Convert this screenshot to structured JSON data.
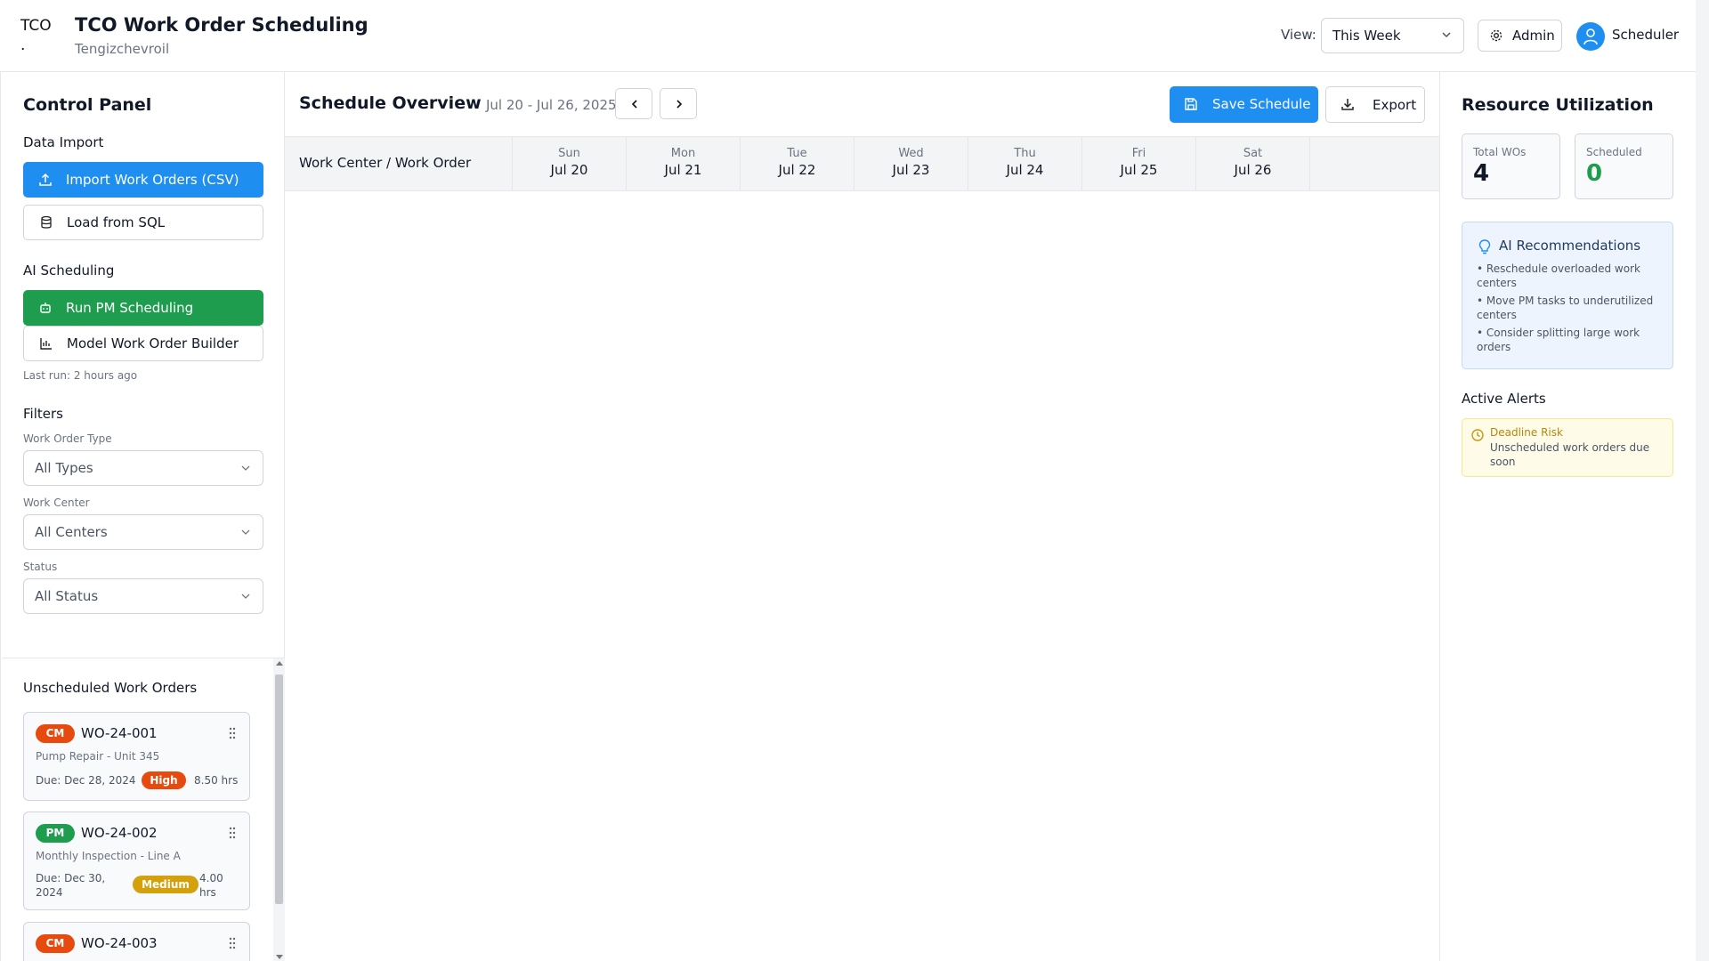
{
  "header": {
    "logo_alt": "TCO .",
    "title": "TCO Work Order Scheduling",
    "subtitle": "Tengizchevroil",
    "view_label": "View:",
    "view_value": "This Week",
    "admin_label": "Admin",
    "user_label": "Scheduler"
  },
  "left": {
    "title": "Control Panel",
    "data_import_label": "Data Import",
    "import_csv": "Import Work Orders (CSV)",
    "load_sql": "Load from SQL",
    "ai_label": "AI Scheduling",
    "run_pm": "Run PM Scheduling",
    "model_builder": "Model Work Order Builder",
    "last_run": "Last run: 2 hours ago",
    "filters_label": "Filters",
    "filters": [
      {
        "label": "Work Order Type",
        "value": "All Types"
      },
      {
        "label": "Work Center",
        "value": "All Centers"
      },
      {
        "label": "Status",
        "value": "All Status"
      }
    ],
    "unscheduled_title": "Unscheduled Work Orders",
    "work_orders": [
      {
        "type": "CM",
        "id": "WO-24-001",
        "desc": "Pump Repair - Unit 345",
        "due": "Due: Dec 28, 2024",
        "priority": "High",
        "hours": "8.50 hrs"
      },
      {
        "type": "PM",
        "id": "WO-24-002",
        "desc": "Monthly Inspection - Line A",
        "due": "Due: Dec 30, 2024",
        "priority": "Medium",
        "hours": "4.00 hrs"
      },
      {
        "type": "CM",
        "id": "WO-24-003",
        "desc": "",
        "due": "",
        "priority": "",
        "hours": ""
      }
    ]
  },
  "center": {
    "title": "Schedule Overview",
    "date_range": "Jul 20 - Jul 26, 2025",
    "save_label": "Save Schedule",
    "export_label": "Export",
    "wc_header": "Work Center / Work Order",
    "days": [
      {
        "name": "Sun",
        "date": "Jul 20"
      },
      {
        "name": "Mon",
        "date": "Jul 21"
      },
      {
        "name": "Tue",
        "date": "Jul 22"
      },
      {
        "name": "Wed",
        "date": "Jul 23"
      },
      {
        "name": "Thu",
        "date": "Jul 24"
      },
      {
        "name": "Fri",
        "date": "Jul 25"
      },
      {
        "name": "Sat",
        "date": "Jul 26"
      }
    ]
  },
  "right": {
    "title": "Resource Utilization",
    "total_label": "Total WOs",
    "total_value": "4",
    "scheduled_label": "Scheduled",
    "scheduled_value": "0",
    "ai_title": "AI Recommendations",
    "recommendations": [
      "• Reschedule overloaded work centers",
      "• Move PM tasks to underutilized centers",
      "• Consider splitting large work orders"
    ],
    "alerts_title": "Active Alerts",
    "alert_title": "Deadline Risk",
    "alert_text": "Unscheduled work orders due soon"
  },
  "colors": {
    "primary": "#1f8ef1",
    "success": "#1f9d4f",
    "cm": "#e64a0e",
    "medium": "#d4a00b"
  }
}
